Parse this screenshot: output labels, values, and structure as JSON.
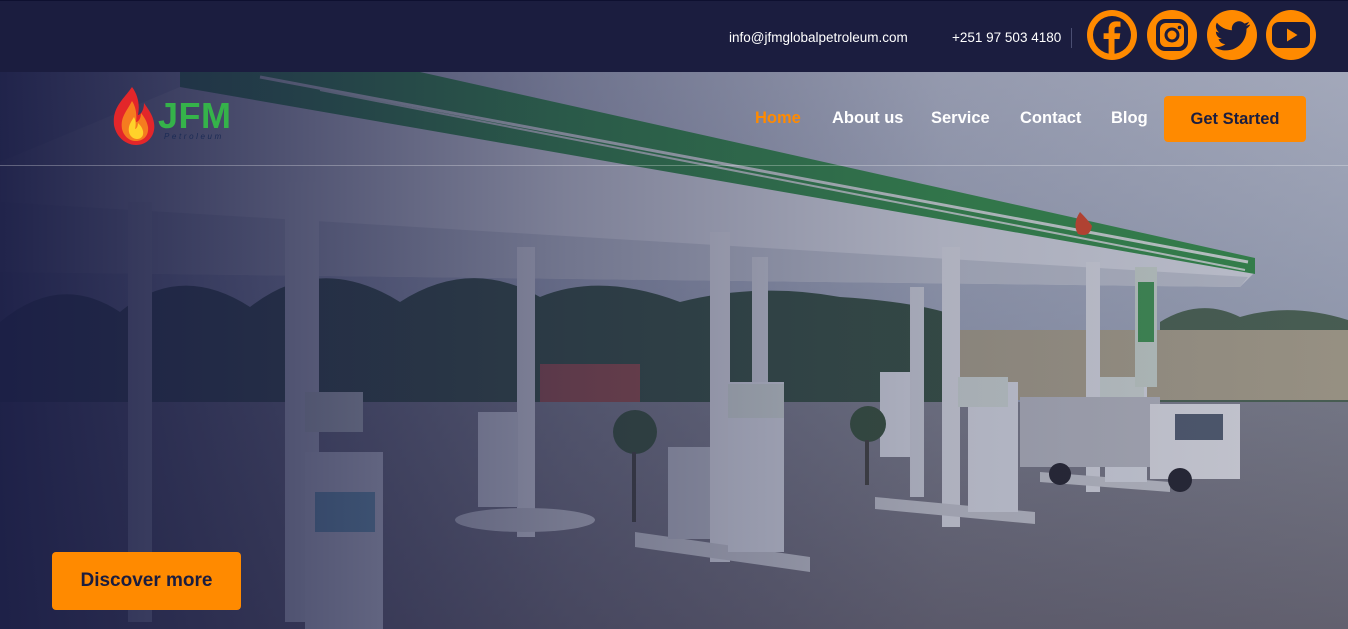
{
  "topbar": {
    "email": "info@jfmglobalpetroleum.com",
    "phone": "+251 97 503 4180",
    "social": [
      "facebook-icon",
      "instagram-icon",
      "twitter-icon",
      "youtube-icon"
    ]
  },
  "brand": {
    "name": "JFM",
    "tagline": "Petroleum"
  },
  "nav": {
    "items": [
      {
        "label": "Home",
        "active": true
      },
      {
        "label": "About us"
      },
      {
        "label": "Service"
      },
      {
        "label": "Contact"
      },
      {
        "label": "Blog"
      }
    ],
    "cta": "Get Started"
  },
  "hero": {
    "button": "Discover more"
  },
  "colors": {
    "accent": "#ff8a00",
    "navy": "#1b1d3f",
    "brand_green": "#35b34a"
  }
}
